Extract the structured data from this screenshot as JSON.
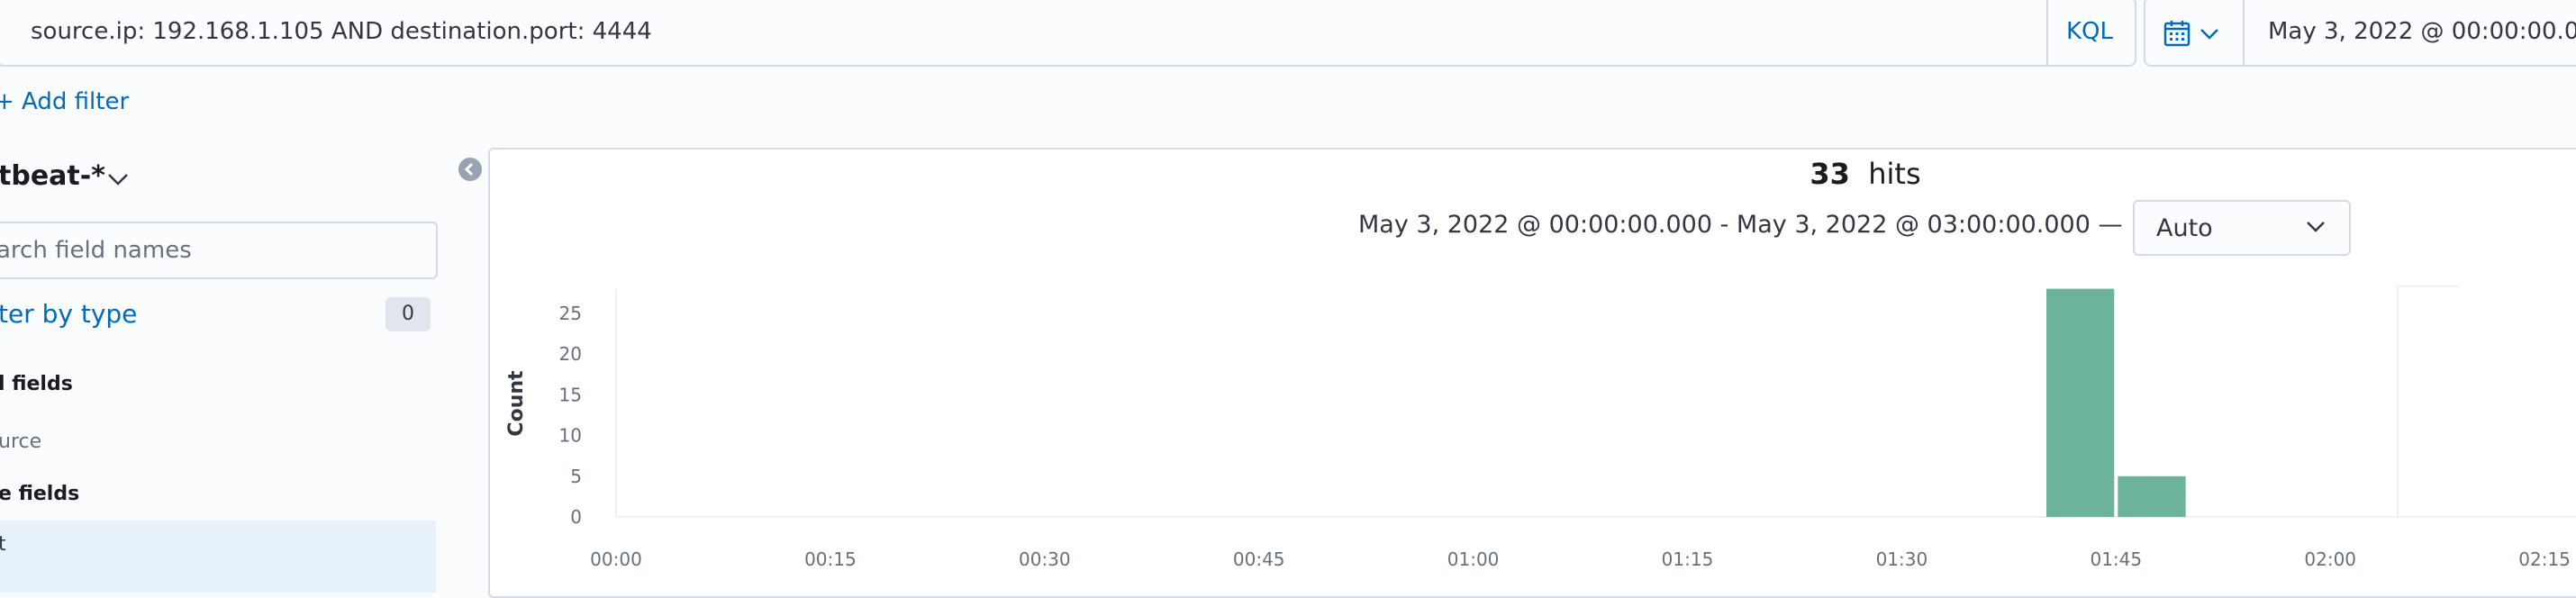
{
  "query": {
    "text": "source.ip: 192.168.1.105 AND destination.port: 4444",
    "language": "KQL"
  },
  "date_picker": {
    "start": "May 3, 2022 @ 00:00:00.0"
  },
  "filters": {
    "add_label": "+ Add filter"
  },
  "sidebar": {
    "index_pattern": "tbeat-*",
    "search_placeholder": "arch field names",
    "filter_by_type": "ter by type",
    "filter_count": "0",
    "selected_fields_label": "l fields",
    "selected_fields": [
      "urce"
    ],
    "available_fields_label": "e fields",
    "available_first": "t"
  },
  "results": {
    "hit_count": "33",
    "hits_label": "hits",
    "time_range": "May 3, 2022 @ 00:00:00.000 - May 3, 2022 @ 03:00:00.000 —",
    "interval": "Auto"
  },
  "colors": {
    "accent": "#006bb8",
    "bar": "#6db39b",
    "border": "#d3dae6"
  },
  "chart_data": {
    "type": "bar",
    "ylabel": "Count",
    "yticks": [
      "0",
      "5",
      "10",
      "15",
      "20",
      "25"
    ],
    "ylim": [
      0,
      28
    ],
    "xticks": [
      "00:00",
      "00:15",
      "00:30",
      "00:45",
      "01:00",
      "01:15",
      "01:30",
      "01:45",
      "02:00",
      "02:15"
    ],
    "xlim_minutes": [
      0,
      140
    ],
    "bin_minutes": 5,
    "categories": [
      "01:40",
      "01:45"
    ],
    "values": [
      28,
      5
    ]
  }
}
